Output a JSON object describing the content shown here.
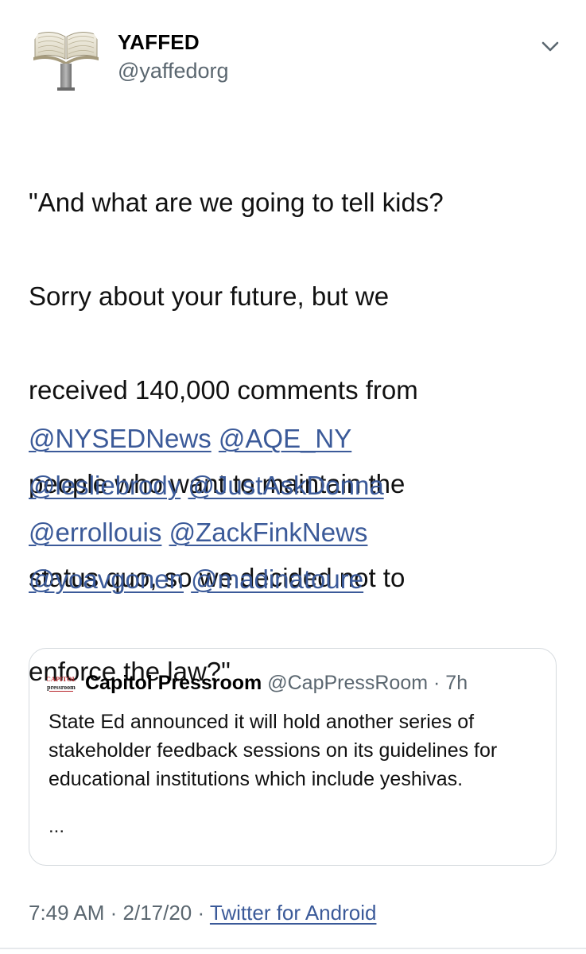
{
  "author": {
    "name": "YAFFED",
    "handle": "@yaffedorg",
    "avatar_icon": "open-book-on-stand-icon"
  },
  "menu_icon": "chevron-down-icon",
  "tweet": {
    "text_lines": [
      "\"And what are we going to tell kids?",
      "Sorry about your future, but we",
      "received 140,000 comments from",
      "people who want to maintain the",
      "status quo, so we decided not to",
      "enforce the law?\""
    ],
    "mention_lines": [
      [
        "@NYSEDNews",
        "@AQE_NY"
      ],
      [
        "@lesliebrody",
        "@JustAskDonna"
      ],
      [
        "@errollouis",
        "@ZackFinkNews"
      ],
      [
        "@yoavgonen",
        "@madinatoure"
      ]
    ]
  },
  "quoted_tweet": {
    "logo_text_top": "CAPITOL",
    "logo_text_bottom": "pressroom",
    "name": "Capitol Pressroom",
    "handle": "@CapPressRoom",
    "separator": " · ",
    "age": "7h",
    "text": "State Ed announced it will hold another series of stakeholder feedback sessions on its guidelines for educational institutions which include yeshivas.",
    "ellipsis": "..."
  },
  "meta": {
    "time": "7:49 AM",
    "separator": " · ",
    "date": "2/17/20",
    "source": "Twitter for Android"
  },
  "colors": {
    "link": "#3b5a99",
    "secondary_text": "#5b6770",
    "card_border": "#d5dade"
  }
}
